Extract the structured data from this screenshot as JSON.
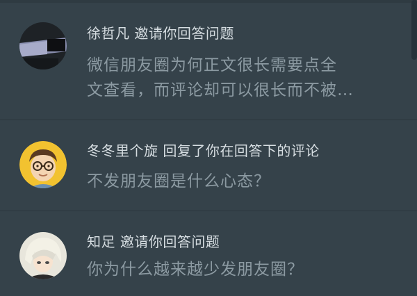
{
  "notifications": [
    {
      "actor": "徐哲凡",
      "action": "邀请你回答问题",
      "body_line1": "微信朋友圈为何正文很长需要点全",
      "body_line2": "文查看，而评论却可以很长而不被…",
      "avatar_icon": "abstract-dark-shapes-avatar"
    },
    {
      "actor": "冬冬里个旋",
      "action": "回复了你在回答下的评论",
      "body_line1": "不发朋友圈是什么心态？",
      "avatar_icon": "cartoon-boy-glasses-avatar"
    },
    {
      "actor": "知足",
      "action": "邀请你回答问题",
      "body_line1": "你为什么越来越少发朋友圈？",
      "avatar_icon": "anime-character-avatar"
    }
  ],
  "colors": {
    "background": "#35424a",
    "title_text": "#d6dde1",
    "body_text": "#8c9aa2",
    "divider": "#2b363d"
  }
}
